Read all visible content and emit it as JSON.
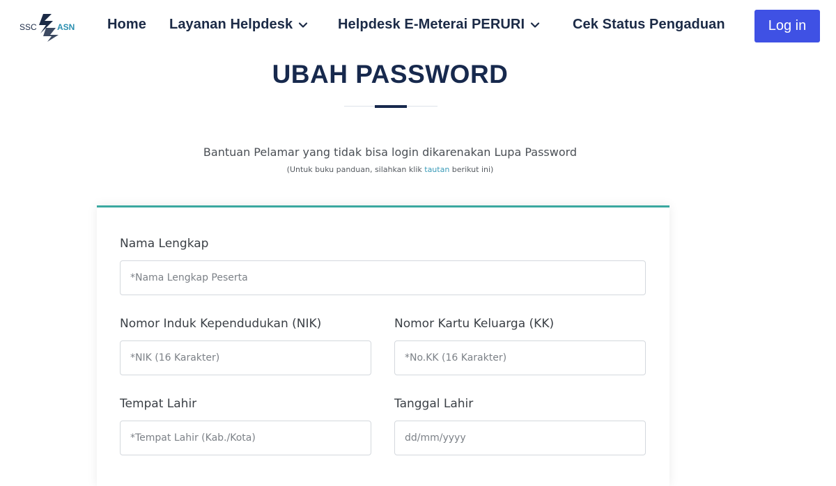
{
  "brand": {
    "logo_text_left": "SSC",
    "logo_text_right": "ASN",
    "accent": "#3f51e4",
    "teal": "#3aa8a0",
    "navy": "#17294d"
  },
  "nav": {
    "home": "Home",
    "layanan": "Layanan Helpdesk",
    "meterai": "Helpdesk E-Meterai PERURI",
    "cek_status": "Cek Status Pengaduan",
    "login": "Log in"
  },
  "page": {
    "title": "UBAH PASSWORD",
    "subtitle": "Bantuan Pelamar yang tidak bisa login dikarenakan Lupa Password",
    "note_prefix": "(Untuk buku panduan, silahkan klik ",
    "note_link": "tautan",
    "note_suffix": " berikut ini)"
  },
  "form": {
    "nama": {
      "label": "Nama Lengkap",
      "placeholder": "*Nama Lengkap Peserta",
      "value": ""
    },
    "nik": {
      "label": "Nomor Induk Kependudukan (NIK)",
      "placeholder": "*NIK (16 Karakter)",
      "value": ""
    },
    "kk": {
      "label": "Nomor Kartu Keluarga (KK)",
      "placeholder": "*No.KK (16 Karakter)",
      "value": ""
    },
    "tempat_lahir": {
      "label": "Tempat Lahir",
      "placeholder": "*Tempat Lahir (Kab./Kota)",
      "value": ""
    },
    "tanggal_lahir": {
      "label": "Tanggal Lahir",
      "placeholder": "dd/mm/yyyy",
      "value": ""
    }
  },
  "icons": {
    "logo": "sscasn-logo",
    "dropdown": "chevron-down-icon"
  }
}
